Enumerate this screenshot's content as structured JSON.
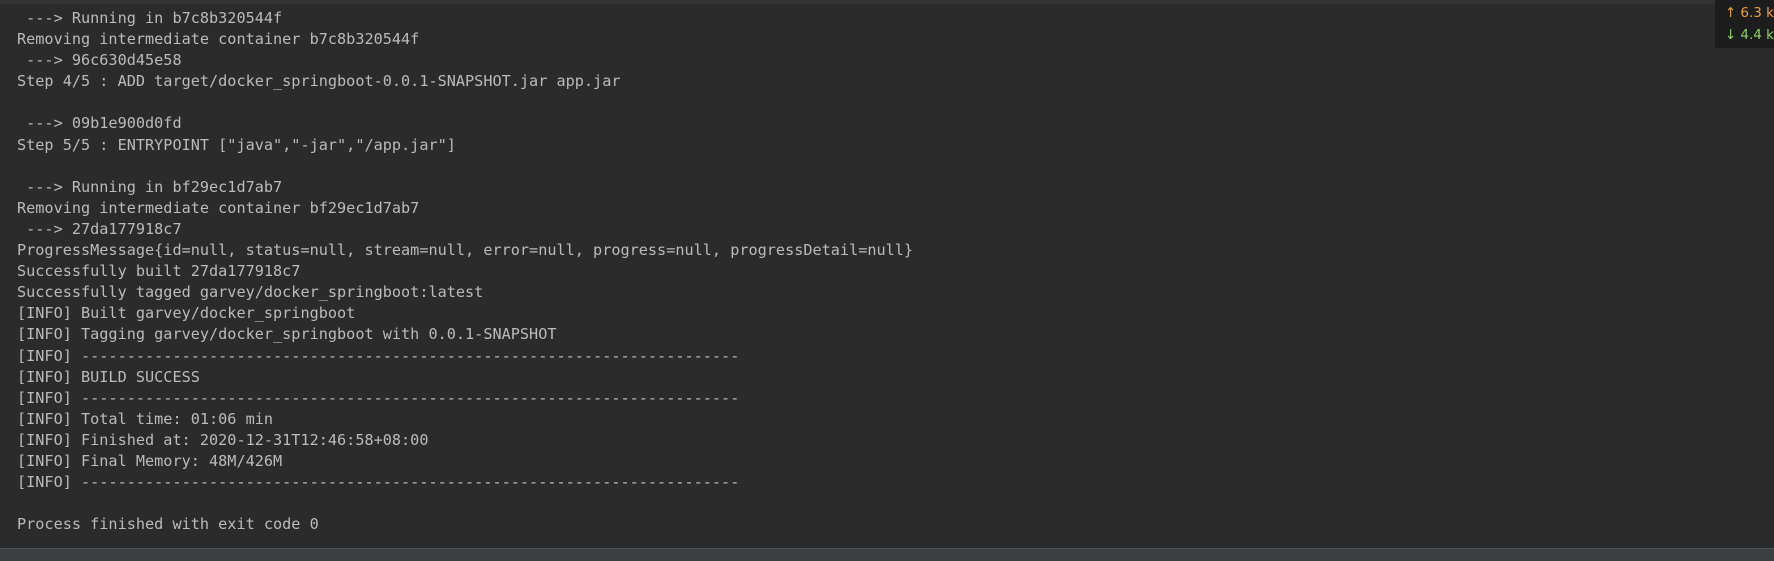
{
  "console": {
    "lines": [
      " ---> Running in b7c8b320544f",
      "Removing intermediate container b7c8b320544f",
      " ---> 96c630d45e58",
      "Step 4/5 : ADD target/docker_springboot-0.0.1-SNAPSHOT.jar app.jar",
      "",
      " ---> 09b1e900d0fd",
      "Step 5/5 : ENTRYPOINT [\"java\",\"-jar\",\"/app.jar\"]",
      "",
      " ---> Running in bf29ec1d7ab7",
      "Removing intermediate container bf29ec1d7ab7",
      " ---> 27da177918c7",
      "ProgressMessage{id=null, status=null, stream=null, error=null, progress=null, progressDetail=null}",
      "Successfully built 27da177918c7",
      "Successfully tagged garvey/docker_springboot:latest",
      "[INFO] Built garvey/docker_springboot",
      "[INFO] Tagging garvey/docker_springboot with 0.0.1-SNAPSHOT",
      "[INFO] ------------------------------------------------------------------------",
      "[INFO] BUILD SUCCESS",
      "[INFO] ------------------------------------------------------------------------",
      "[INFO] Total time: 01:06 min",
      "[INFO] Finished at: 2020-12-31T12:46:58+08:00",
      "[INFO] Final Memory: 48M/426M",
      "[INFO] ------------------------------------------------------------------------",
      "",
      "Process finished with exit code 0"
    ]
  },
  "network": {
    "upload": "6.3 k",
    "download": "4.4 k",
    "upload_icon": "up-arrow-icon",
    "download_icon": "down-arrow-icon",
    "upload_color": "#e8a04a",
    "download_color": "#8ed06a"
  },
  "colors": {
    "background": "#2b2b2b",
    "text": "#bbbbbb"
  }
}
